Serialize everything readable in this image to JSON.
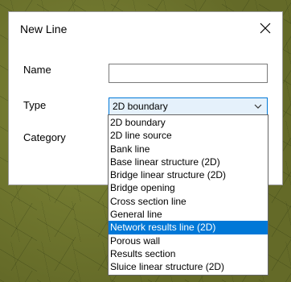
{
  "dialog": {
    "title": "New Line",
    "close_icon": "close-icon"
  },
  "form": {
    "name_label": "Name",
    "name_value": "",
    "type_label": "Type",
    "type_value": "2D boundary",
    "category_label": "Category"
  },
  "dropdown": {
    "selected_index": 8,
    "options": [
      "2D boundary",
      "2D line source",
      "Bank line",
      "Base linear structure (2D)",
      "Bridge linear structure (2D)",
      "Bridge opening",
      "Cross section line",
      "General line",
      "Network results line (2D)",
      "Porous wall",
      "Results section",
      "Sluice linear structure (2D)"
    ]
  },
  "colors": {
    "highlight": "#0078d7",
    "select_background": "#e5f1fb",
    "backdrop": "#6e7530"
  }
}
